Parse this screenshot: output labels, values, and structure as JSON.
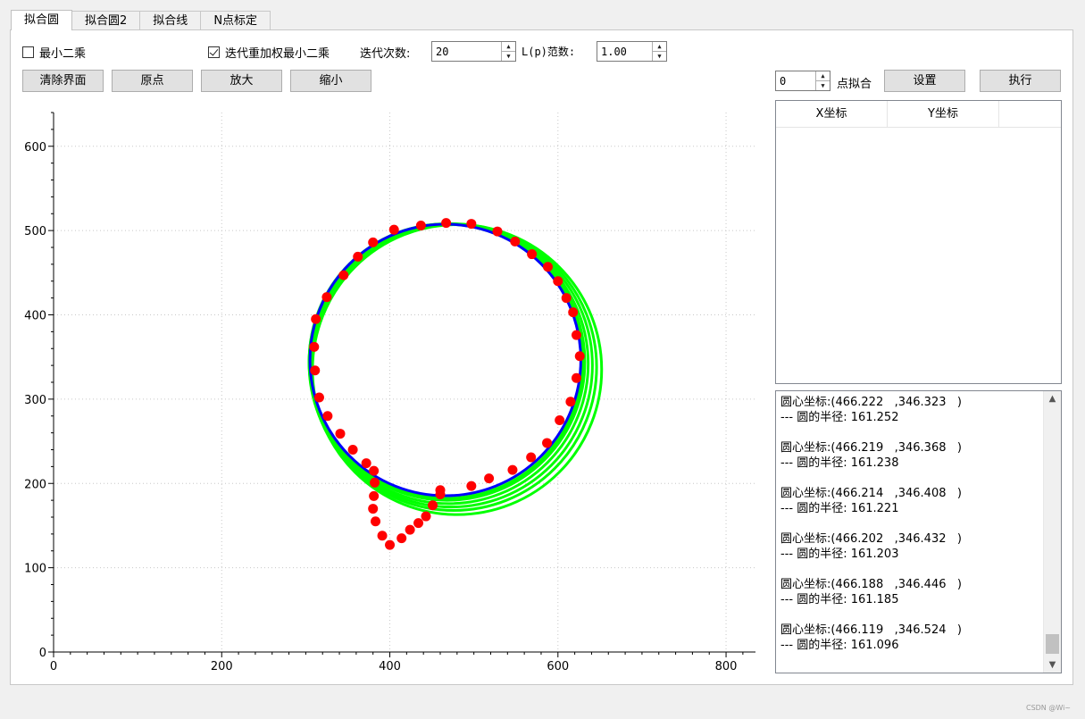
{
  "tabs": [
    "拟合圆",
    "拟合圆2",
    "拟合线",
    "N点标定"
  ],
  "options": {
    "least_squares_label": "最小二乘",
    "least_squares_checked": false,
    "irls_label": "迭代重加权最小二乘",
    "irls_checked": true,
    "iterations_label": "迭代次数:",
    "iterations_value": "20",
    "lp_label": "L(p)范数:",
    "lp_value": "1.00"
  },
  "buttons": {
    "clear": "清除界面",
    "origin": "原点",
    "zoom_in": "放大",
    "zoom_out": "缩小",
    "settings": "设置",
    "execute": "执行"
  },
  "point_fit": {
    "value": "0",
    "label": "点拟合"
  },
  "table": {
    "columns": [
      "X坐标",
      "Y坐标"
    ]
  },
  "log": [
    {
      "line1": "圆心坐标:(466.222   ,346.323   )",
      "line2": "--- 圆的半径: 161.252"
    },
    {
      "line1": "圆心坐标:(466.219   ,346.368   )",
      "line2": "--- 圆的半径: 161.238"
    },
    {
      "line1": "圆心坐标:(466.214   ,346.408   )",
      "line2": "--- 圆的半径: 161.221"
    },
    {
      "line1": "圆心坐标:(466.202   ,346.432   )",
      "line2": "--- 圆的半径: 161.203"
    },
    {
      "line1": "圆心坐标:(466.188   ,346.446   )",
      "line2": "--- 圆的半径: 161.185"
    },
    {
      "line1": "圆心坐标:(466.119   ,346.524   )",
      "line2": "--- 圆的半径: 161.096"
    }
  ],
  "watermark": "CSDN @Wi~",
  "colors": {
    "points": "#ff0000",
    "fit_circle": "#0000ff",
    "iterations": "#00ff00"
  },
  "chart_data": {
    "type": "scatter",
    "xlim": [
      0,
      835
    ],
    "ylim": [
      0,
      640
    ],
    "x_ticks": [
      0,
      200,
      400,
      600,
      800
    ],
    "y_ticks": [
      0,
      100,
      200,
      300,
      400,
      500,
      600
    ],
    "grid": true,
    "points": [
      [
        312,
        395
      ],
      [
        310,
        362
      ],
      [
        311,
        334
      ],
      [
        316,
        302
      ],
      [
        326,
        280
      ],
      [
        341,
        259
      ],
      [
        356,
        240
      ],
      [
        372,
        224
      ],
      [
        381,
        215
      ],
      [
        382,
        201
      ],
      [
        381,
        185
      ],
      [
        380,
        170
      ],
      [
        383,
        155
      ],
      [
        391,
        138
      ],
      [
        400,
        127
      ],
      [
        414,
        135
      ],
      [
        424,
        145
      ],
      [
        434,
        153
      ],
      [
        443,
        161
      ],
      [
        451,
        174
      ],
      [
        460,
        187
      ],
      [
        460,
        192
      ],
      [
        497,
        197
      ],
      [
        518,
        206
      ],
      [
        546,
        216
      ],
      [
        568,
        231
      ],
      [
        587,
        248
      ],
      [
        602,
        275
      ],
      [
        615,
        297
      ],
      [
        622,
        325
      ],
      [
        626,
        351
      ],
      [
        622,
        376
      ],
      [
        618,
        403
      ],
      [
        610,
        420
      ],
      [
        600,
        440
      ],
      [
        588,
        457
      ],
      [
        569,
        472
      ],
      [
        549,
        487
      ],
      [
        528,
        499
      ],
      [
        497,
        508
      ],
      [
        467,
        509
      ],
      [
        437,
        506
      ],
      [
        405,
        501
      ],
      [
        380,
        486
      ],
      [
        362,
        469
      ],
      [
        345,
        447
      ],
      [
        325,
        421
      ]
    ],
    "fit_circle": {
      "cx": 466.1,
      "cy": 346.5,
      "r": 161.1
    },
    "iteration_circles": [
      {
        "cx": 480,
        "cy": 335,
        "r": 172
      },
      {
        "cx": 476,
        "cy": 338,
        "r": 170
      },
      {
        "cx": 473,
        "cy": 340,
        "r": 168
      },
      {
        "cx": 470,
        "cy": 342,
        "r": 166
      },
      {
        "cx": 468,
        "cy": 344,
        "r": 164
      },
      {
        "cx": 467,
        "cy": 345,
        "r": 163
      },
      {
        "cx": 466.2,
        "cy": 346.3,
        "r": 161.3
      }
    ]
  }
}
